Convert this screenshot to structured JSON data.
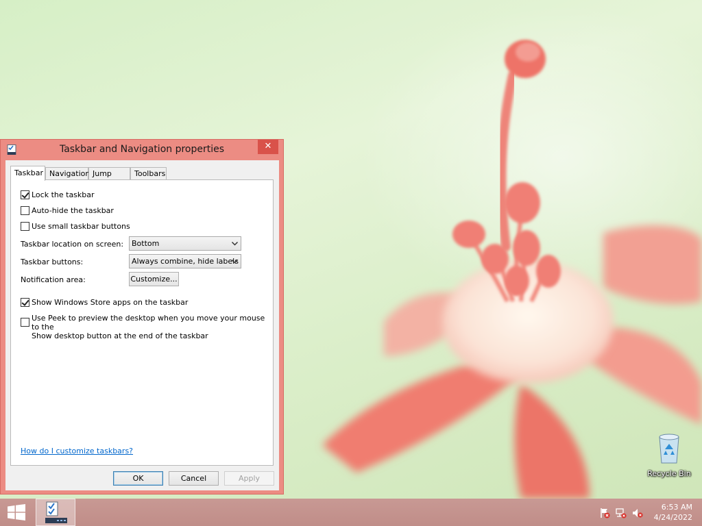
{
  "dialog": {
    "title": "Taskbar and Navigation properties",
    "close_label": "✕",
    "tabs": [
      {
        "label": "Taskbar",
        "active": true
      },
      {
        "label": "Navigation",
        "active": false
      },
      {
        "label": "Jump Lists",
        "active": false
      },
      {
        "label": "Toolbars",
        "active": false
      }
    ],
    "options": {
      "lock_taskbar": {
        "label": "Lock the taskbar",
        "checked": true
      },
      "auto_hide": {
        "label": "Auto-hide the taskbar",
        "checked": false
      },
      "small_buttons": {
        "label": "Use small taskbar buttons",
        "checked": false
      },
      "store_apps": {
        "label": "Show Windows Store apps on the taskbar",
        "checked": true
      },
      "peek": {
        "label_line1": "Use Peek to preview the desktop when you move your mouse to the",
        "label_line2": "Show desktop button at the end of the taskbar",
        "checked": false
      }
    },
    "location": {
      "label": "Taskbar location on screen:",
      "value": "Bottom"
    },
    "buttons_combine": {
      "label": "Taskbar buttons:",
      "value": "Always combine, hide labels"
    },
    "notification": {
      "label": "Notification area:",
      "button": "Customize..."
    },
    "help_link": "How do I customize taskbars?",
    "footer": {
      "ok": "OK",
      "cancel": "Cancel",
      "apply": "Apply"
    }
  },
  "desktop": {
    "recycle_bin_label": "Recycle Bin"
  },
  "taskbar": {
    "time": "6:53 AM",
    "date": "4/24/2022",
    "tray_icons": [
      "action-center-flag-icon",
      "network-icon",
      "volume-muted-icon"
    ]
  },
  "colors": {
    "window_frame": "#ec8c83",
    "close_button": "#d9524a",
    "taskbar": "#c4938e",
    "link": "#0066cc"
  }
}
